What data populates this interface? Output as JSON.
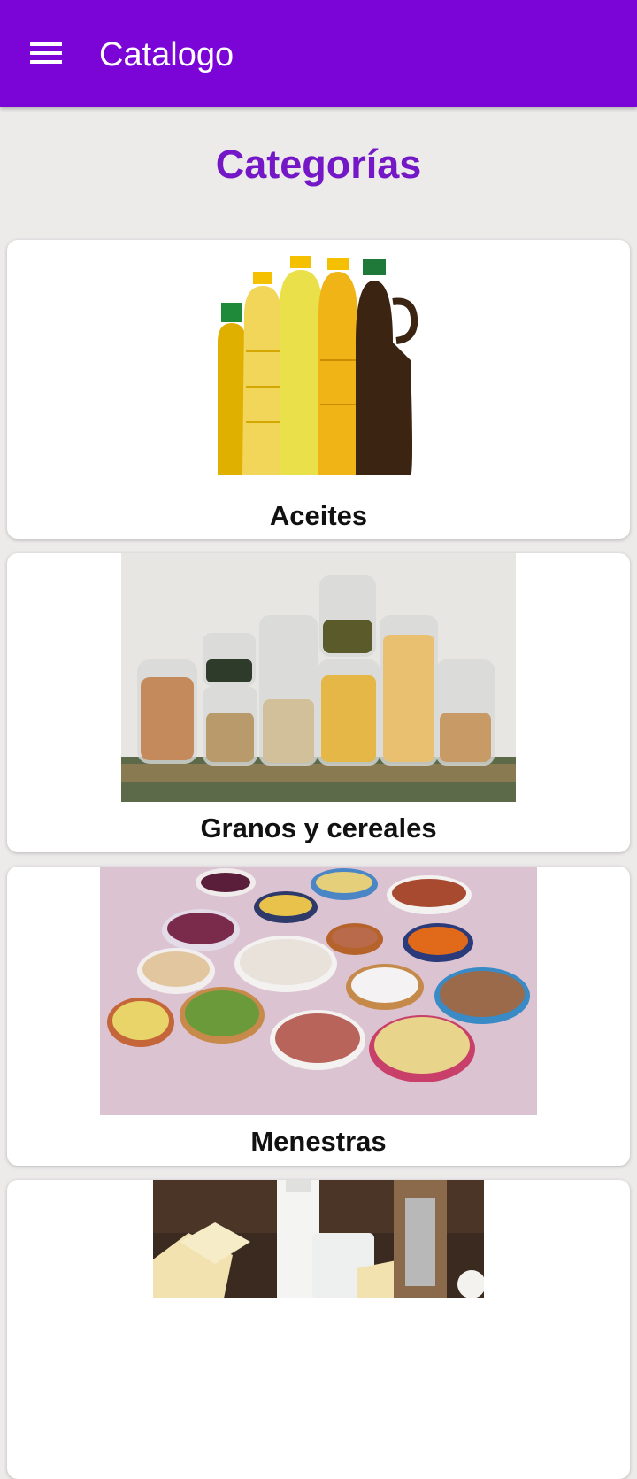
{
  "appbar": {
    "title": "Catalogo"
  },
  "page": {
    "section_title": "Categorías"
  },
  "categories": [
    {
      "label": "Aceites"
    },
    {
      "label": "Granos y cereales"
    },
    {
      "label": "Menestras"
    },
    {
      "label": ""
    }
  ],
  "colors": {
    "appbar": "#7a05d6",
    "accent": "#7418c7",
    "background": "#ecebea"
  }
}
